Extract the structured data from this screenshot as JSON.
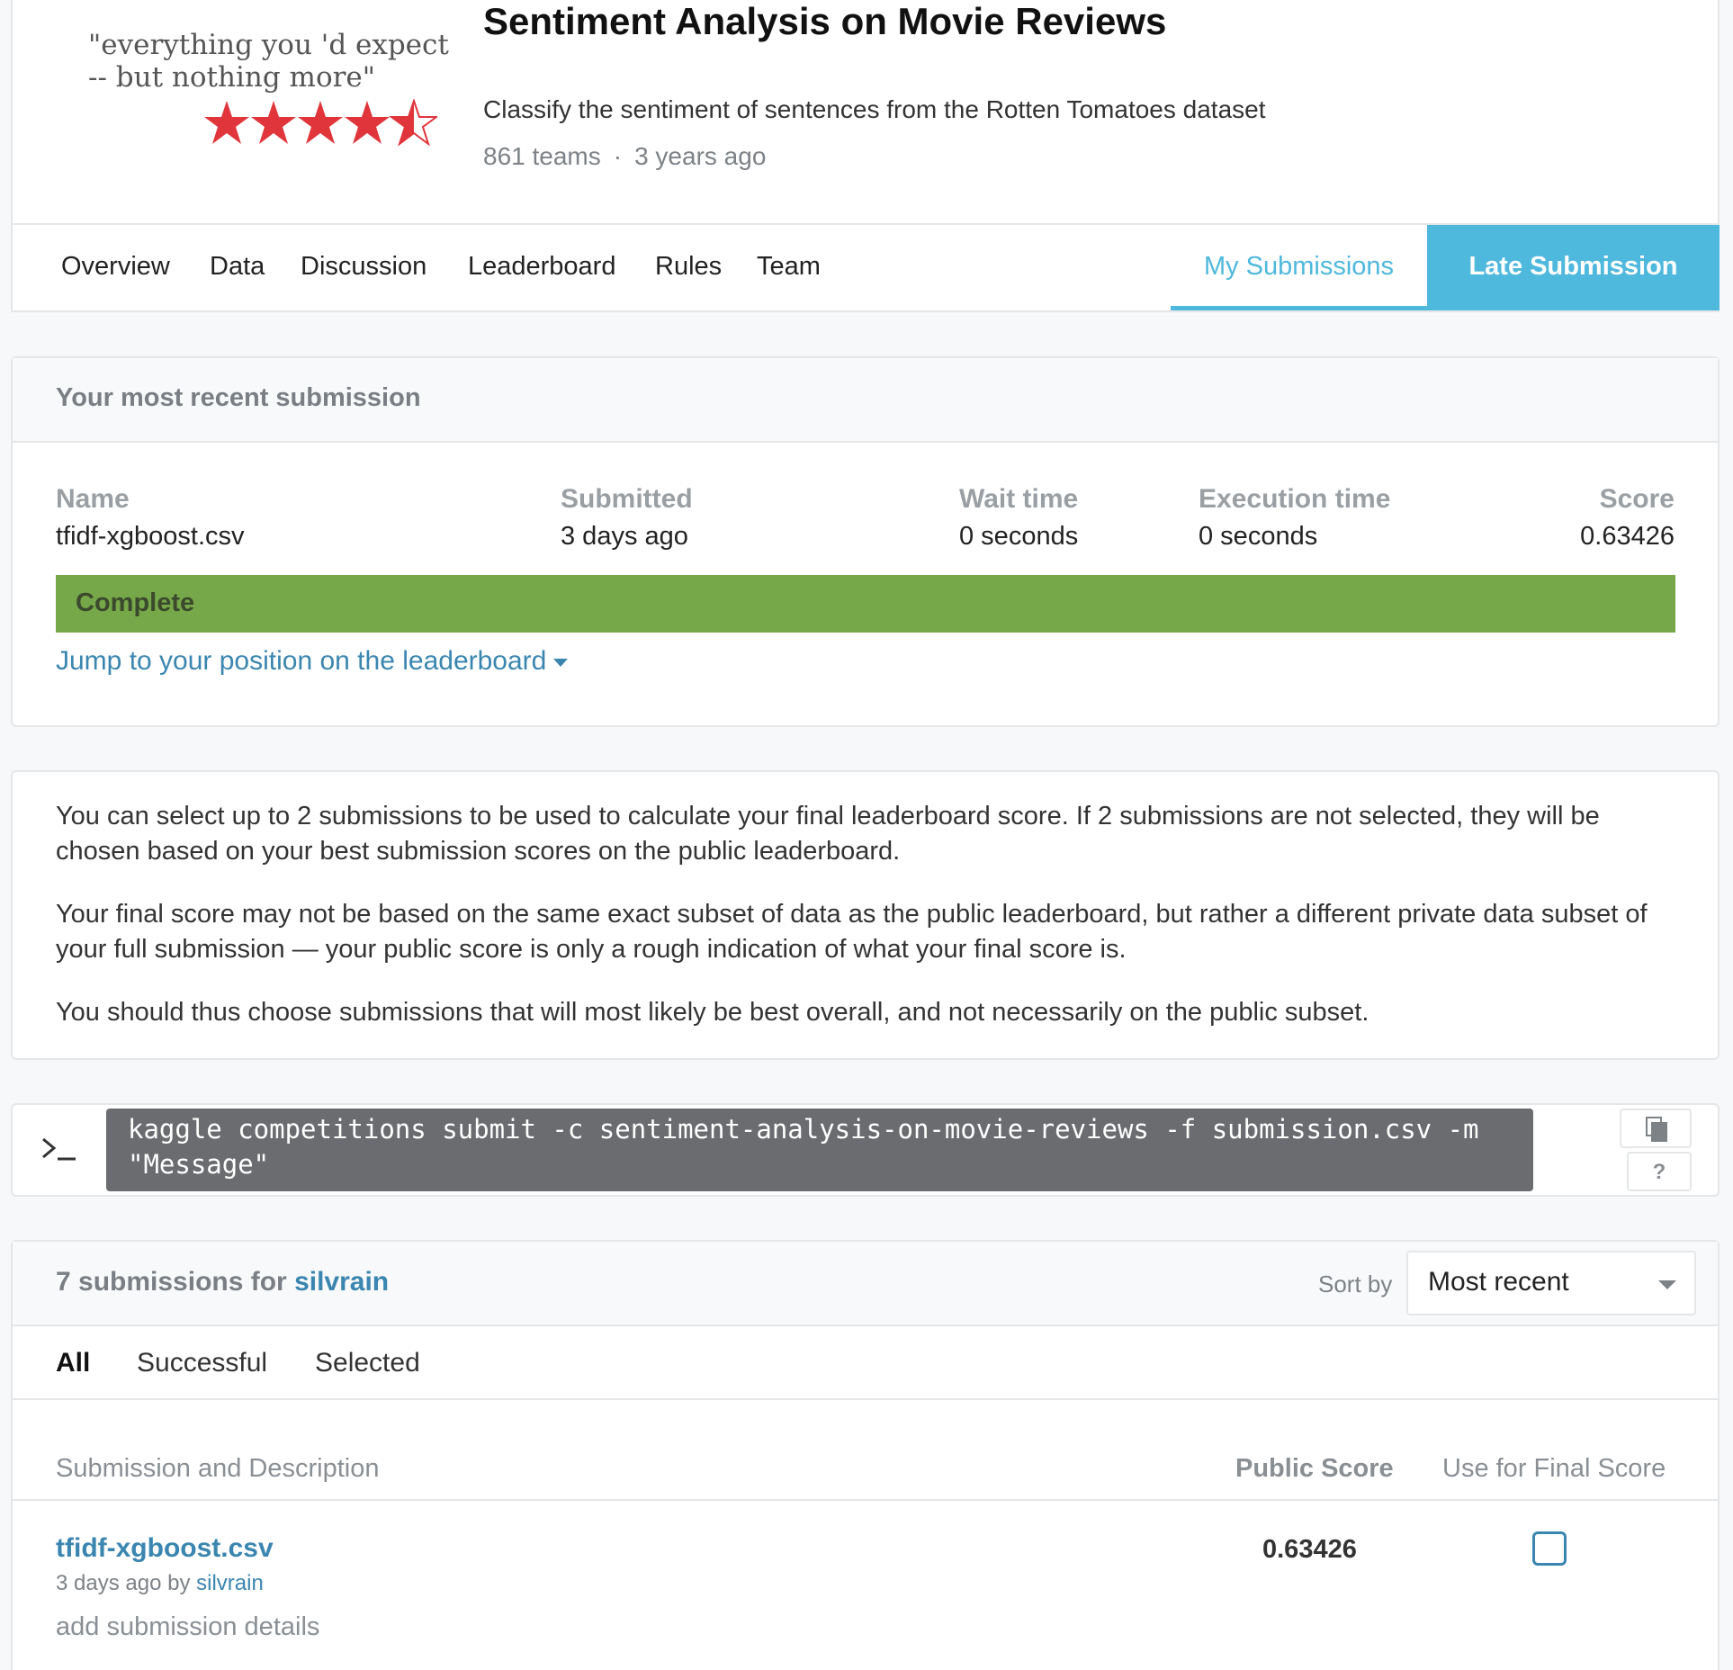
{
  "header": {
    "logo_quote": "\"everything you 'd expect\n-- but nothing more\"",
    "title": "Sentiment Analysis on Movie Reviews",
    "subtitle": "Classify the sentiment of sentences from the Rotten Tomatoes dataset",
    "teams": "861 teams",
    "age": "3 years ago",
    "rating_stars": 4.5
  },
  "tabs": [
    "Overview",
    "Data",
    "Discussion",
    "Leaderboard",
    "Rules",
    "Team"
  ],
  "my_submissions": "My Submissions",
  "late_submission": "Late Submission",
  "recent": {
    "heading": "Your most recent submission",
    "name_label": "Name",
    "name": "tfidf-xgboost.csv",
    "submitted_label": "Submitted",
    "submitted": "3 days ago",
    "wait_label": "Wait time",
    "wait": "0 seconds",
    "exec_label": "Execution time",
    "exec": "0 seconds",
    "score_label": "Score",
    "score": "0.63426",
    "status": "Complete",
    "jump": "Jump to your position on the leaderboard"
  },
  "info": {
    "p1": "You can select up to 2 submissions to be used to calculate your final leaderboard score. If 2 submissions are not selected, they will be chosen based on your best submission scores on the public leaderboard.",
    "p2": "Your final score may not be based on the same exact subset of data as the public leaderboard, but rather a different private data subset of your full submission — your public score is only a rough indication of what your final score is.",
    "p3": "You should thus choose submissions that will most likely be best overall, and not necessarily on the public subset."
  },
  "cli": {
    "command": "kaggle competitions submit -c sentiment-analysis-on-movie-reviews -f submission.csv -m \"Message\"",
    "help": "?"
  },
  "submissions": {
    "count_text": "7 submissions for ",
    "user": "silvrain",
    "sort_label": "Sort by",
    "sort_value": "Most recent",
    "filters": [
      "All",
      "Successful",
      "Selected"
    ],
    "col_desc": "Submission and Description",
    "col_public": "Public Score",
    "col_final": "Use for Final Score",
    "rows": [
      {
        "file": "tfidf-xgboost.csv",
        "when": "3 days ago by ",
        "by": "silvrain",
        "add_details": "add submission details",
        "public_score": "0.63426"
      }
    ]
  }
}
